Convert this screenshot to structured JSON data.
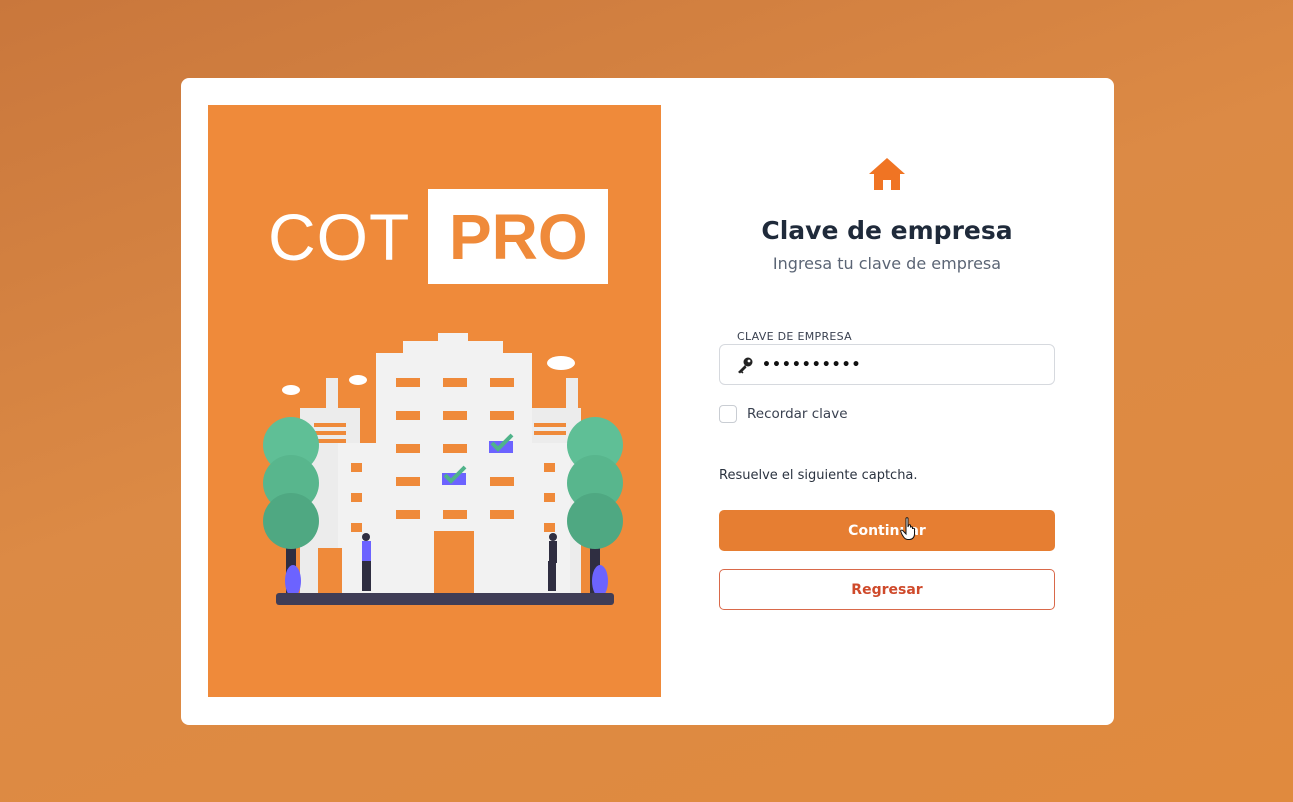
{
  "logo": {
    "part1": "COT",
    "part2": "PRO"
  },
  "form": {
    "icon": "home-icon",
    "title": "Clave de empresa",
    "subtitle": "Ingresa tu clave de empresa",
    "field_label": "CLAVE DE EMPRESA",
    "field_value": "••••••••••",
    "field_icon": "key-icon",
    "remember_label": "Recordar clave",
    "remember_checked": false,
    "captcha_text": "Resuelve el siguiente captcha.",
    "continue_label": "Continuar",
    "back_label": "Regresar"
  },
  "colors": {
    "accent": "#e67e32",
    "panel": "#ef8a3a",
    "secondary_text": "#cf4a2b"
  }
}
